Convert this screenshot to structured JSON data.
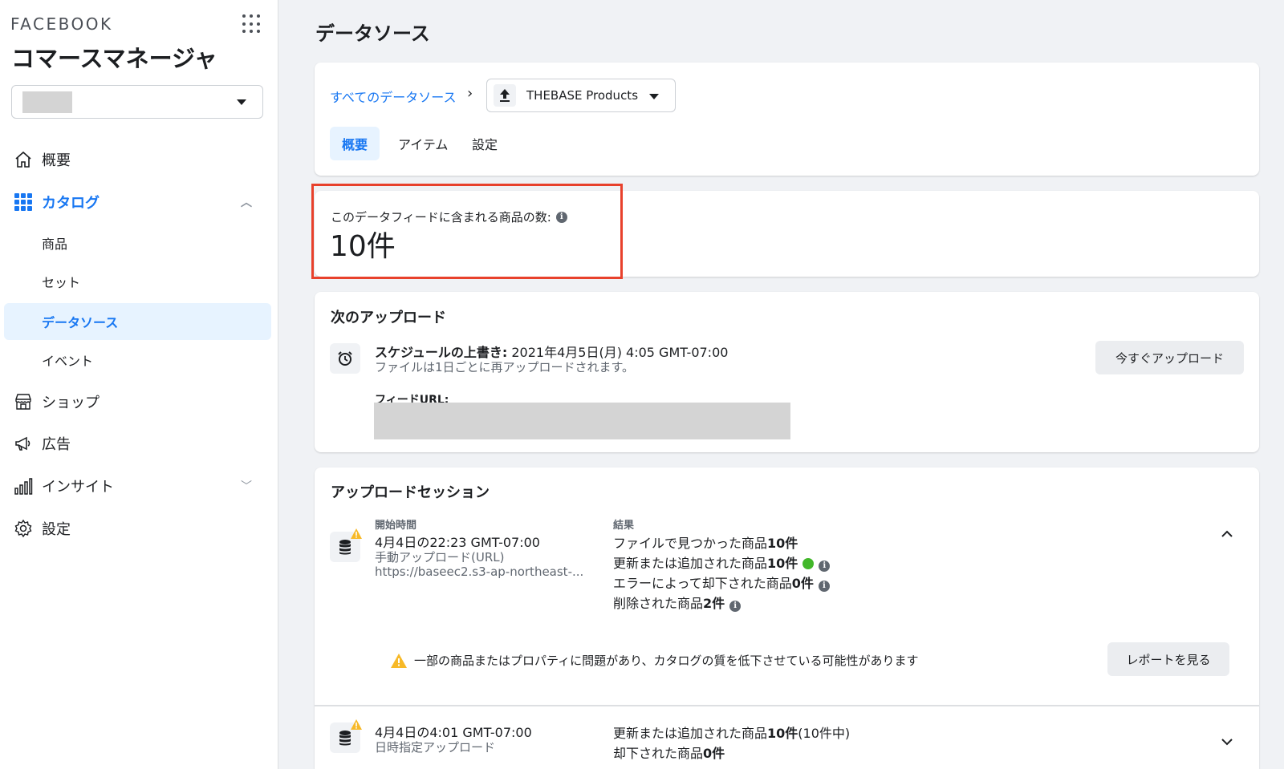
{
  "sidebar": {
    "brand": "FACEBOOK",
    "app_title": "コマースマネージャ",
    "nav": {
      "overview": "概要",
      "catalog": "カタログ",
      "products": "商品",
      "sets": "セット",
      "data_sources": "データソース",
      "events": "イベント",
      "shop": "ショップ",
      "ads": "広告",
      "insights": "インサイト",
      "settings": "設定"
    }
  },
  "page": {
    "title": "データソース"
  },
  "header_card": {
    "breadcrumb_link": "すべてのデータソース",
    "breadcrumb_sep": "›",
    "source_name": "THEBASE Products",
    "tabs": [
      "概要",
      "アイテム",
      "設定"
    ]
  },
  "count_card": {
    "label": "このデータフィードに含まれる商品の数:",
    "value": "10件"
  },
  "next_upload": {
    "title": "次のアップロード",
    "schedule_label": "スケジュールの上書き:",
    "schedule_value": "2021年4月5日(月) 4:05 GMT-07:00",
    "schedule_note": "ファイルは1日ごとに再アップロードされます。",
    "feed_url_label": "フィードURL:",
    "upload_now": "今すぐアップロード"
  },
  "sessions": {
    "title": "アップロードセッション",
    "col_start": "開始時間",
    "col_result": "結果",
    "session1": {
      "time": "4月4日の22:23 GMT-07:00",
      "method": "手動アップロード(URL)",
      "url": "https://baseec2.s3-ap-northeast-...",
      "found_prefix": "ファイルで見つかった商品",
      "found_count": "10件",
      "updated_prefix": "更新または追加された商品",
      "updated_count": "10件",
      "rejected_prefix": "エラーによって却下された商品",
      "rejected_count": "0件",
      "deleted_prefix": "削除された商品",
      "deleted_count": "2件",
      "warning": "一部の商品またはプロパティに問題があり、カタログの質を低下させている可能性があります",
      "report_button": "レポートを見る"
    },
    "session2": {
      "time": "4月4日の4:01 GMT-07:00",
      "method": "日時指定アップロード",
      "updated_prefix": "更新または追加された商品",
      "updated_count": "10件",
      "updated_suffix": "(10件中)",
      "rejected_prefix": "却下された商品",
      "rejected_count": "0件"
    }
  },
  "colors": {
    "accent": "#1877f2",
    "highlight": "#e8412c",
    "success": "#42b72a",
    "warning": "#f7b928"
  }
}
